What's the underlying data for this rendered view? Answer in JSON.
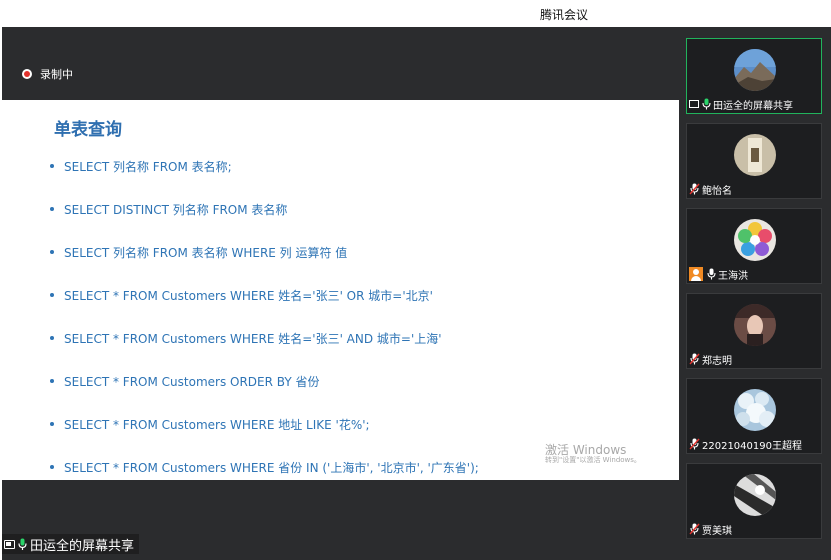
{
  "window": {
    "title": "腾讯会议"
  },
  "recording": {
    "label": "录制中"
  },
  "slide": {
    "title": "单表查询",
    "items": [
      "SELECT 列名称 FROM 表名称;",
      "SELECT DISTINCT 列名称 FROM 表名称",
      "SELECT 列名称 FROM 表名称 WHERE 列 运算符 值",
      "SELECT * FROM Customers WHERE 姓名='张三' OR 城市='北京'",
      "SELECT * FROM Customers WHERE 姓名='张三' AND 城市='上海'",
      "SELECT * FROM Customers ORDER BY 省份",
      "SELECT * FROM Customers WHERE 地址 LIKE '花%';",
      "SELECT * FROM Customers WHERE 省份 IN ('上海市', '北京市', '广东省');"
    ],
    "watermark_line1": "激活 Windows",
    "watermark_line2": "转到\"设置\"以激活 Windows。"
  },
  "share_label": "田运全的屏幕共享",
  "participants": [
    {
      "name": "田运全的屏幕共享",
      "type": "screen",
      "avatar": "mountain-avatar"
    },
    {
      "name": "鲍怡名",
      "type": "muted",
      "avatar": "photo-avatar"
    },
    {
      "name": "王海洪",
      "type": "host",
      "avatar": "flower-avatar"
    },
    {
      "name": "郑志明",
      "type": "muted",
      "avatar": "portrait-avatar"
    },
    {
      "name": "22021040190王超程",
      "type": "muted",
      "avatar": "snow-avatar"
    },
    {
      "name": "贾美琪",
      "type": "muted",
      "avatar": "bw-avatar"
    }
  ],
  "colors": {
    "background_dark": "#2b2c2e",
    "slide_text": "#2e74b5",
    "slide_title": "#2f6fb0",
    "active_border": "#21b35c",
    "record_red": "#e2322d",
    "host_orange": "#f08a24"
  }
}
